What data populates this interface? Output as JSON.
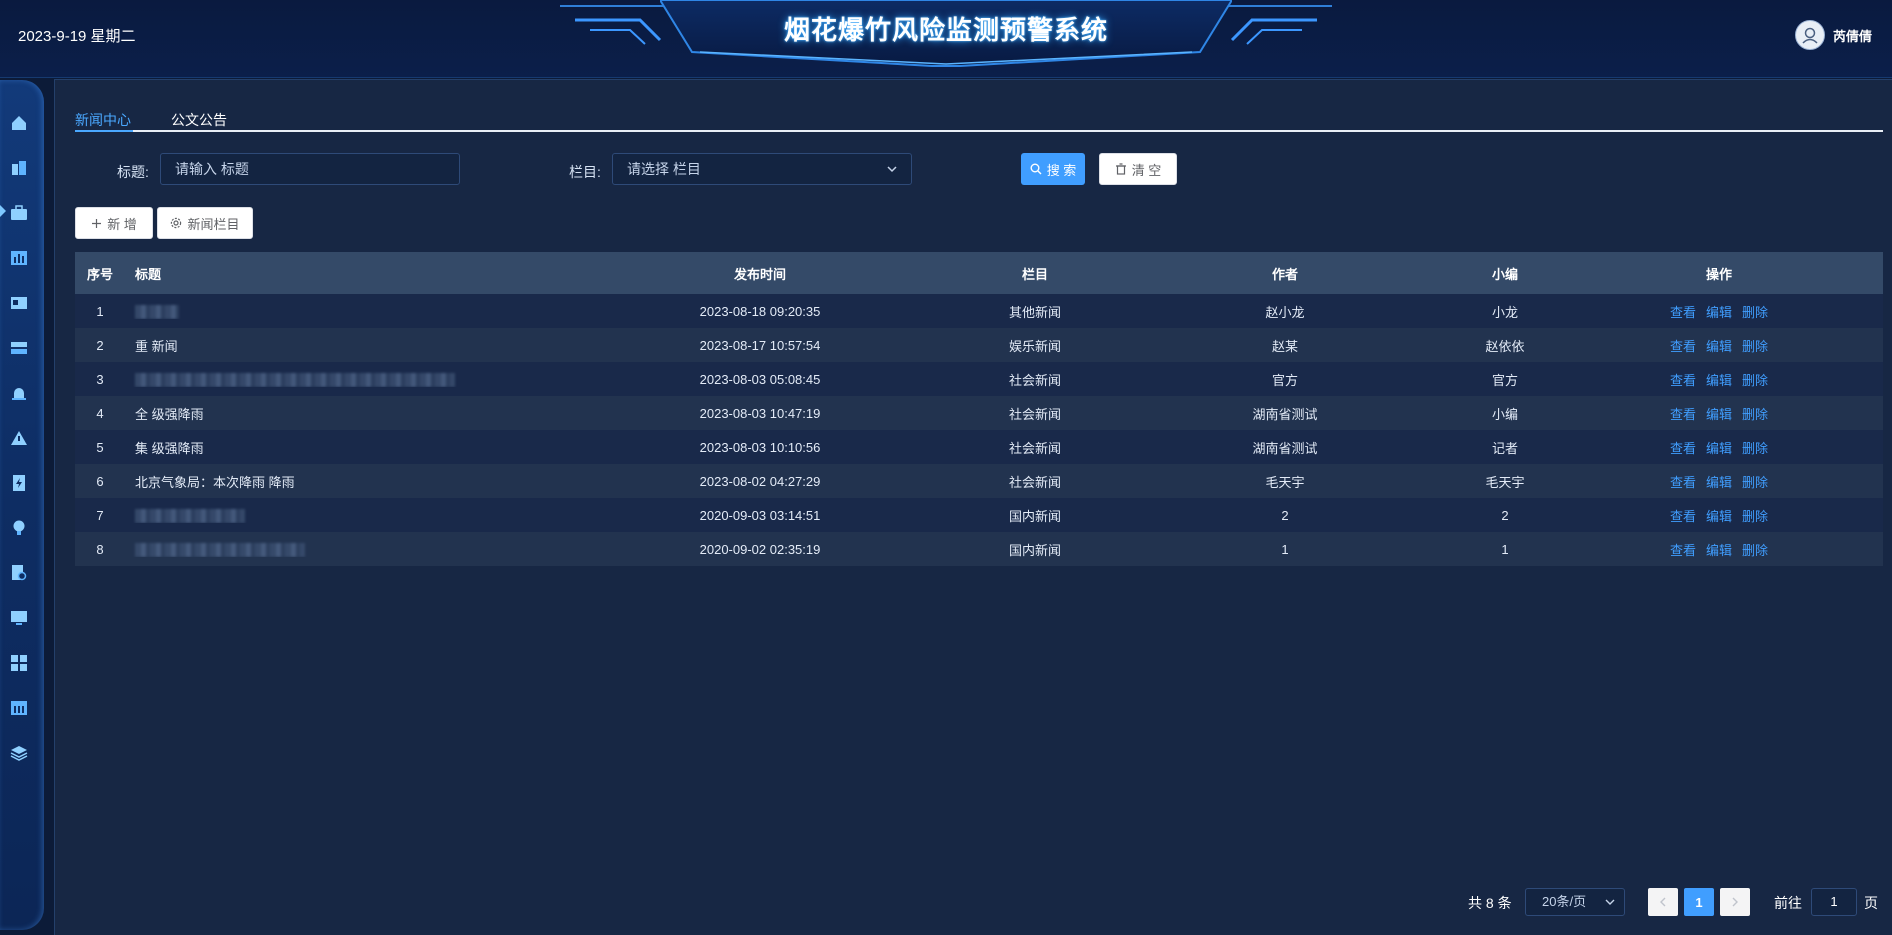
{
  "header": {
    "date": "2023-9-19 星期二",
    "system_title": "烟花爆竹风险监测预警系统",
    "user_name": "芮倩倩"
  },
  "sidebar": {
    "icons": [
      "home-icon",
      "building-icon",
      "briefcase-icon",
      "bar-chart-icon",
      "id-card-icon",
      "server-icon",
      "alarm-light-icon",
      "warning-icon",
      "document-lightning-icon",
      "lightbulb-icon",
      "report-search-icon",
      "monitor-chart-icon",
      "grid-icon",
      "calendar-chart-icon",
      "layers-icon"
    ],
    "active_index": 2
  },
  "tabs": [
    {
      "label": "新闻中心",
      "active": true
    },
    {
      "label": "公文公告",
      "active": false
    }
  ],
  "search": {
    "title_label": "标题:",
    "title_placeholder": "请输入 标题",
    "column_label": "栏目:",
    "column_placeholder": "请选择 栏目",
    "search_button": "搜 索",
    "clear_button": "清 空"
  },
  "toolbar": {
    "add_button": "新 增",
    "column_button": "新闻栏目"
  },
  "table": {
    "headers": {
      "index": "序号",
      "title": "标题",
      "time": "发布时间",
      "column": "栏目",
      "author": "作者",
      "editor": "小编",
      "ops": "操作"
    },
    "ops": {
      "view": "查看",
      "edit": "编辑",
      "delete": "删除"
    },
    "rows": [
      {
        "index": "1",
        "title": "",
        "time": "2023-08-18 09:20:35",
        "column": "其他新闻",
        "author": "赵小龙",
        "editor": "小龙"
      },
      {
        "index": "2",
        "title": "重 新闻",
        "time": "2023-08-17 10:57:54",
        "column": "娱乐新闻",
        "author": "赵某",
        "editor": "赵依依"
      },
      {
        "index": "3",
        "title": "",
        "time": "2023-08-03 05:08:45",
        "column": "社会新闻",
        "author": "官方",
        "editor": "官方"
      },
      {
        "index": "4",
        "title": "全 级强降雨",
        "time": "2023-08-03 10:47:19",
        "column": "社会新闻",
        "author": "湖南省测试",
        "editor": "小编"
      },
      {
        "index": "5",
        "title": "集 级强降雨",
        "time": "2023-08-03 10:10:56",
        "column": "社会新闻",
        "author": "湖南省测试",
        "editor": "记者"
      },
      {
        "index": "6",
        "title": "北京气象局：本次降雨 降雨",
        "time": "2023-08-02 04:27:29",
        "column": "社会新闻",
        "author": "毛天宇",
        "editor": "毛天宇"
      },
      {
        "index": "7",
        "title": "",
        "time": "2020-09-03 03:14:51",
        "column": "国内新闻",
        "author": "2",
        "editor": "2"
      },
      {
        "index": "8",
        "title": "",
        "time": "2020-09-02 02:35:19",
        "column": "国内新闻",
        "author": "1",
        "editor": "1"
      }
    ]
  },
  "pagination": {
    "total_text": "共 8 条",
    "page_size": "20条/页",
    "current_page": "1",
    "goto_label": "前往",
    "goto_value": "1",
    "goto_suffix": "页"
  },
  "colors": {
    "accent": "#409eff",
    "background": "#172744",
    "header_bg": "#0b1f4a"
  }
}
